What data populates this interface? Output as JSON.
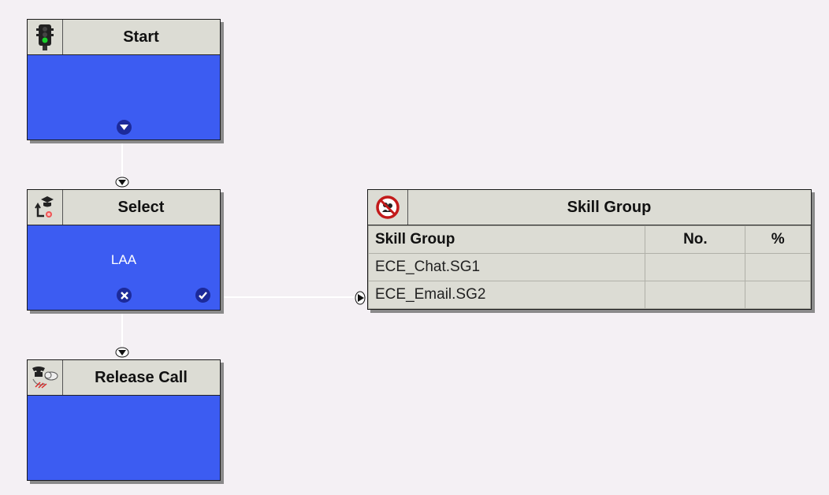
{
  "nodes": {
    "start": {
      "title": "Start"
    },
    "select": {
      "title": "Select",
      "body_text": "LAA"
    },
    "release": {
      "title": "Release Call"
    }
  },
  "skill_group_table": {
    "title": "Skill Group",
    "columns": [
      "Skill Group",
      "No.",
      "%"
    ],
    "rows": [
      {
        "name": "ECE_Chat.SG1",
        "no": "",
        "pct": ""
      },
      {
        "name": "ECE_Email.SG2",
        "no": "",
        "pct": ""
      }
    ]
  },
  "icons": {
    "start": "traffic-light-icon",
    "select": "select-node-icon",
    "release": "release-call-phone-icon",
    "skill_group": "skill-group-no-entry-icon"
  },
  "colors": {
    "node_body": "#3c5cf2",
    "header": "#dcdcd4",
    "port": "#1c2a9a",
    "canvas": "#f4f0f4"
  }
}
